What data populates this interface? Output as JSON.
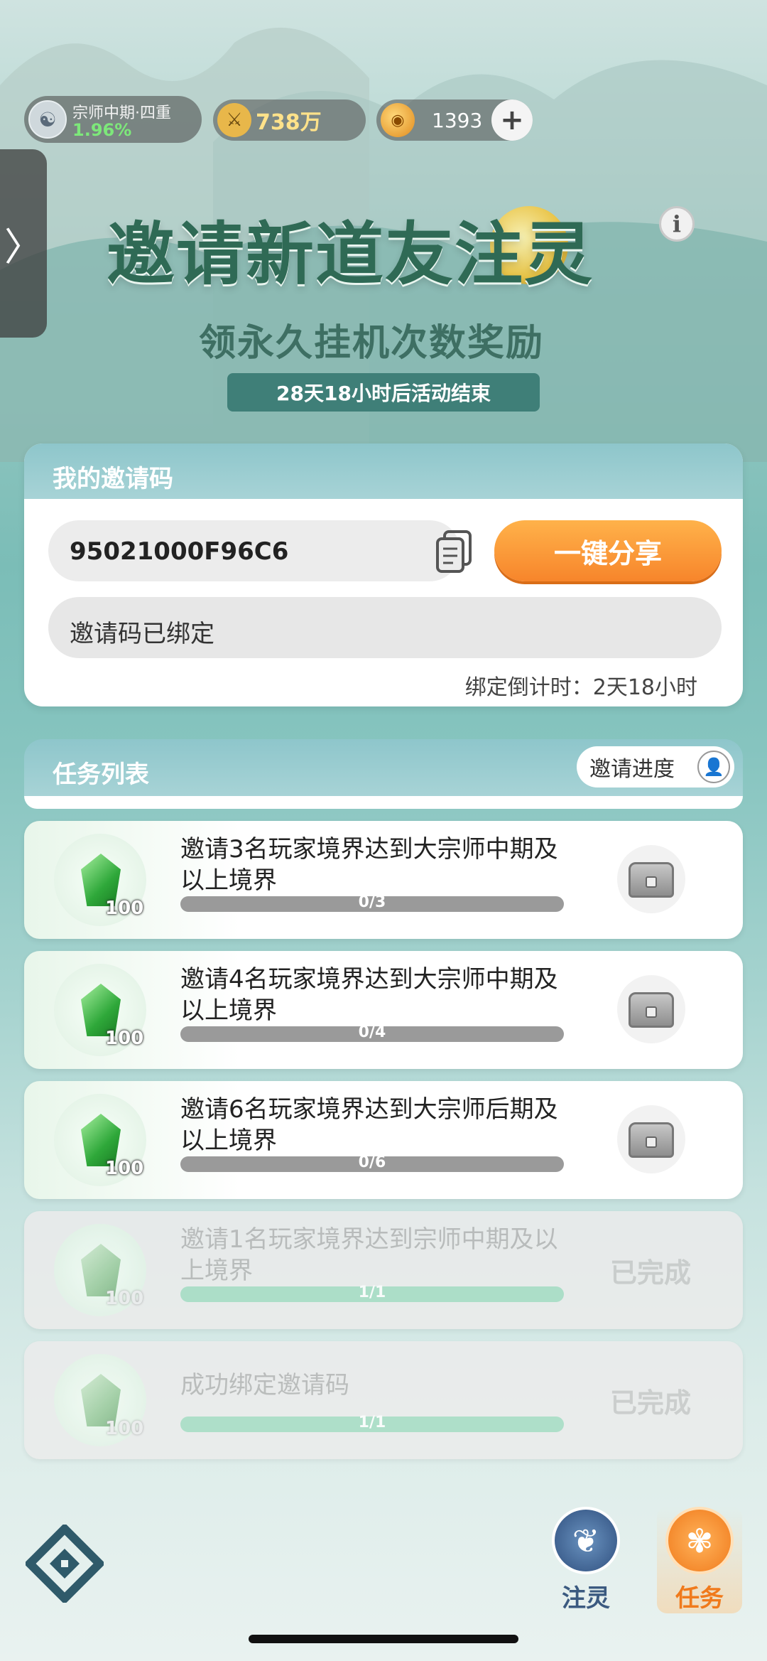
{
  "status": {
    "realm_name": "宗师中期·四重",
    "realm_percent": "1.96%",
    "power": "738万",
    "currency": "1393",
    "plus": "+"
  },
  "drawer": {
    "arrow": "〉"
  },
  "banner": {
    "title": "邀请新道友注灵",
    "subtitle": "领永久挂机次数奖励",
    "countdown": "28天18小时后活动结束",
    "info": "i"
  },
  "invite": {
    "header": "我的邀请码",
    "code": "95021000F96C6",
    "share_label": "一键分享",
    "bound_text": "邀请码已绑定",
    "bind_countdown": "绑定倒计时：2天18小时"
  },
  "tasks": {
    "header": "任务列表",
    "progress_btn": "邀请进度",
    "items": [
      {
        "text": "邀请3名玩家境界达到大宗师中期及以上境界",
        "reward": "100",
        "progress": "0/3",
        "fill": 0,
        "status": ""
      },
      {
        "text": "邀请4名玩家境界达到大宗师中期及以上境界",
        "reward": "100",
        "progress": "0/4",
        "fill": 0,
        "status": ""
      },
      {
        "text": "邀请6名玩家境界达到大宗师后期及以上境界",
        "reward": "100",
        "progress": "0/6",
        "fill": 0,
        "status": ""
      },
      {
        "text": "邀请1名玩家境界达到宗师中期及以上境界",
        "reward": "100",
        "progress": "1/1",
        "fill": 1,
        "status": "已完成"
      },
      {
        "text": "成功绑定邀请码",
        "reward": "100",
        "progress": "1/1",
        "fill": 1,
        "status": "已完成"
      }
    ]
  },
  "nav": {
    "zhuling": "注灵",
    "renwu": "任务"
  }
}
